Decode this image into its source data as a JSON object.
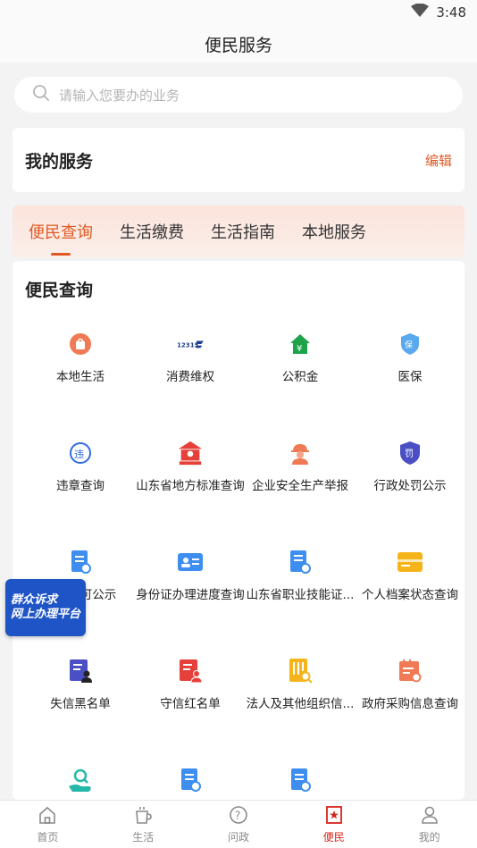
{
  "status": {
    "time": "3:48"
  },
  "header": {
    "title": "便民服务"
  },
  "search": {
    "placeholder": "请输入您要办的业务"
  },
  "my_services": {
    "title": "我的服务",
    "edit": "编辑"
  },
  "tabs": [
    {
      "label": "便民查询"
    },
    {
      "label": "生活缴费"
    },
    {
      "label": "生活指南"
    },
    {
      "label": "本地服务"
    }
  ],
  "section": {
    "title": "便民查询",
    "items": [
      {
        "label": "本地生活",
        "icon": "shopping-basket-icon"
      },
      {
        "label": "消费维权",
        "icon": "12315-icon"
      },
      {
        "label": "公积金",
        "icon": "house-yen-icon"
      },
      {
        "label": "医保",
        "icon": "insurance-shield-icon"
      },
      {
        "label": "违章查询",
        "icon": "violation-icon"
      },
      {
        "label": "山东省地方标准查询",
        "icon": "building-icon"
      },
      {
        "label": "企业安全生产举报",
        "icon": "worker-helmet-icon"
      },
      {
        "label": "行政处罚公示",
        "icon": "penalty-shield-icon"
      },
      {
        "label": "可公示",
        "icon": "document-certificate-icon"
      },
      {
        "label": "身份证办理进度查询",
        "icon": "id-card-icon"
      },
      {
        "label": "山东省职业技能证...",
        "icon": "skill-certificate-icon"
      },
      {
        "label": "个人档案状态查询",
        "icon": "archive-folder-icon"
      },
      {
        "label": "失信黑名单",
        "icon": "blacklist-icon"
      },
      {
        "label": "守信红名单",
        "icon": "redlist-icon"
      },
      {
        "label": "法人及其他组织信...",
        "icon": "organization-search-icon"
      },
      {
        "label": "政府采购信息查询",
        "icon": "procurement-calendar-icon"
      },
      {
        "label": "",
        "icon": "hand-search-icon"
      },
      {
        "label": "",
        "icon": "document-certificate-icon"
      },
      {
        "label": "",
        "icon": "document-certificate-icon"
      }
    ]
  },
  "floating_badge": {
    "line1": "群众诉求",
    "line2": "网上办理平台"
  },
  "bottom_nav": [
    {
      "label": "首页",
      "icon": "home-icon"
    },
    {
      "label": "生活",
      "icon": "cup-icon"
    },
    {
      "label": "问政",
      "icon": "question-icon"
    },
    {
      "label": "便民",
      "icon": "star-flag-icon"
    },
    {
      "label": "我的",
      "icon": "person-icon"
    }
  ],
  "colors": {
    "accent": "#e05a24",
    "nav_active": "#d6241c",
    "badge_blue": "#1e54c6"
  }
}
